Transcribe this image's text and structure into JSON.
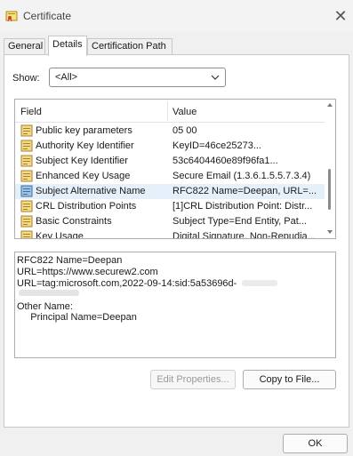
{
  "window": {
    "title": "Certificate",
    "close_icon": "close-icon"
  },
  "tabs": [
    {
      "label": "General",
      "active": false
    },
    {
      "label": "Details",
      "active": true
    },
    {
      "label": "Certification Path",
      "active": false
    }
  ],
  "show": {
    "label": "Show:",
    "selected": "<All>"
  },
  "fields_list": {
    "columns": {
      "field": "Field",
      "value": "Value"
    },
    "rows": [
      {
        "field": "Public key parameters",
        "value": "05 00",
        "icon": "cert-field-icon",
        "selected": false
      },
      {
        "field": "Authority Key Identifier",
        "value": "KeyID=46ce25273...",
        "icon": "cert-field-icon",
        "selected": false
      },
      {
        "field": "Subject Key Identifier",
        "value": "53c6404460e89f96fa1...",
        "icon": "cert-field-icon",
        "selected": false
      },
      {
        "field": "Enhanced Key Usage",
        "value": "Secure Email (1.3.6.1.5.5.7.3.4)",
        "icon": "cert-field-icon",
        "selected": false
      },
      {
        "field": "Subject Alternative Name",
        "value": "RFC822 Name=Deepan, URL=...",
        "icon": "cert-field-icon",
        "selected": true
      },
      {
        "field": "CRL Distribution Points",
        "value": "[1]CRL Distribution Point: Distr...",
        "icon": "cert-field-icon",
        "selected": false
      },
      {
        "field": "Basic Constraints",
        "value": "Subject Type=End Entity, Pat...",
        "icon": "cert-field-icon",
        "selected": false
      },
      {
        "field": "Key Usage",
        "value": "Digital Signature, Non-Repudia...",
        "icon": "cert-field-icon",
        "selected": false
      }
    ]
  },
  "detail": {
    "lines": [
      "RFC822 Name=Deepan",
      "URL=https://www.securew2.com",
      "URL=tag:microsoft.com,2022-09-14:sid:5a53696d-",
      "",
      "Other Name:",
      "     Principal Name=Deepan"
    ]
  },
  "buttons": {
    "edit_properties": "Edit Properties...",
    "copy_to_file": "Copy to File...",
    "ok": "OK"
  }
}
